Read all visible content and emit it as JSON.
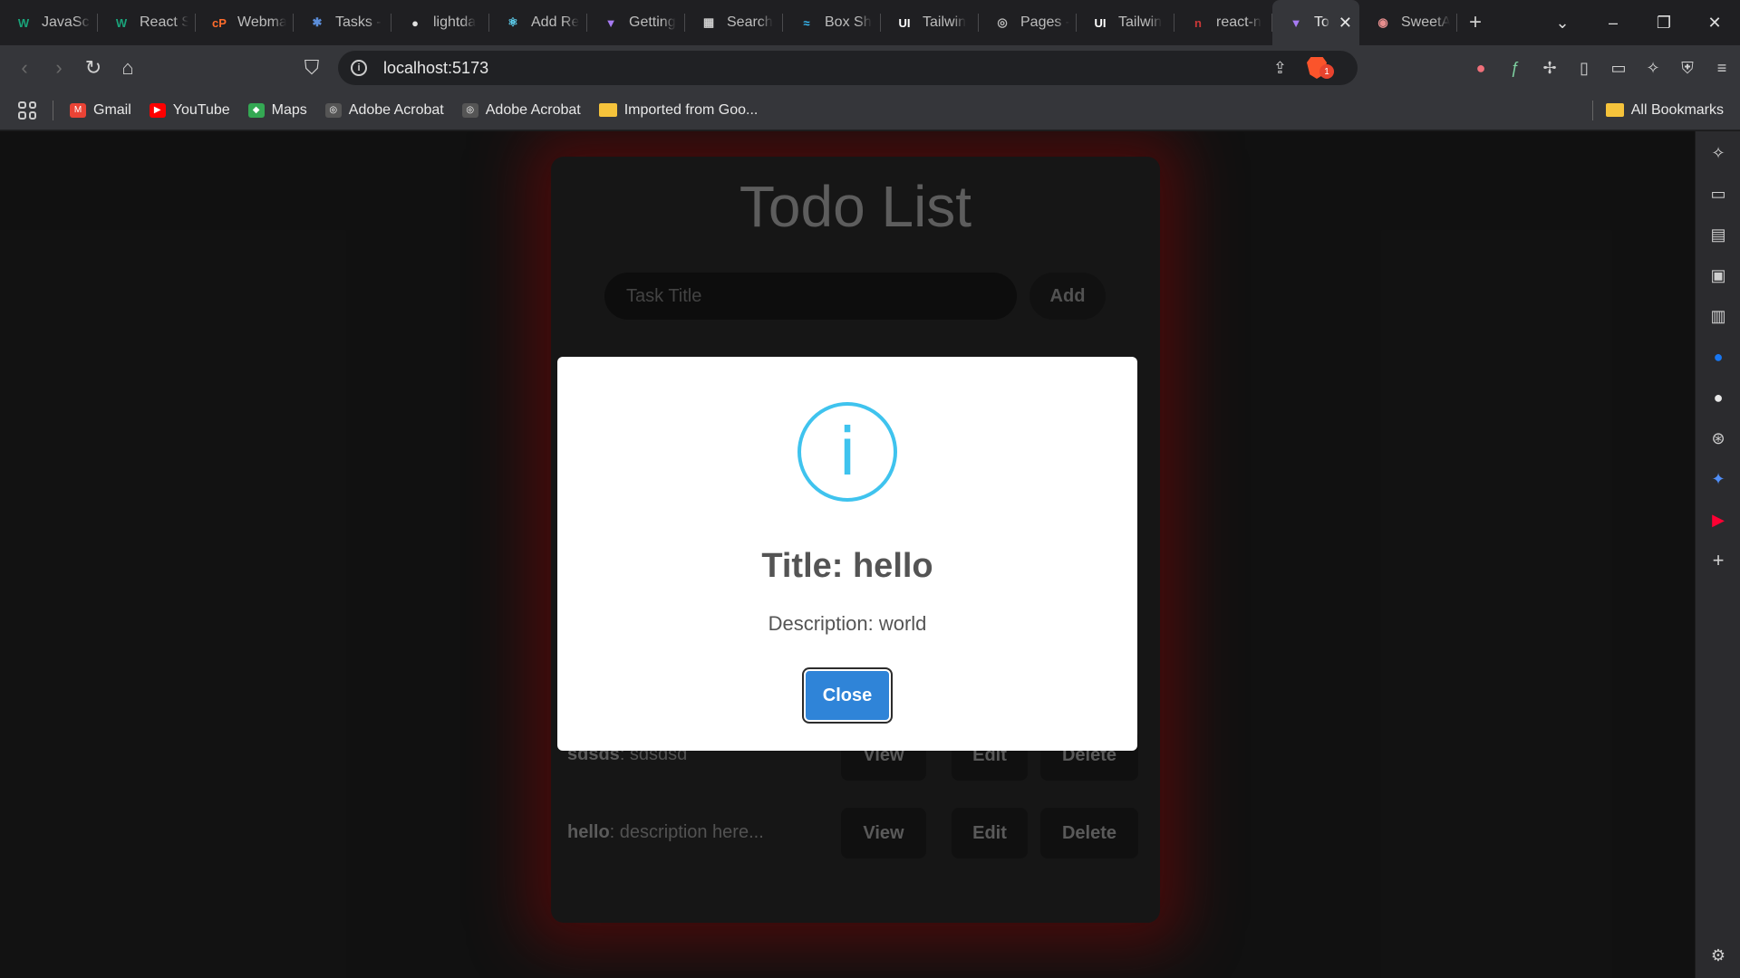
{
  "tabs": [
    {
      "title": "JavaScr",
      "icon": "w-icon",
      "glyph": "W",
      "color": "#1aa37a"
    },
    {
      "title": "React S",
      "icon": "w-icon",
      "glyph": "W",
      "color": "#1aa37a"
    },
    {
      "title": "Webma",
      "icon": "cpanel-icon",
      "glyph": "cP",
      "color": "#ff6c2c"
    },
    {
      "title": "Tasks -",
      "icon": "tasks-icon",
      "glyph": "✱",
      "color": "#5b8dd9"
    },
    {
      "title": "lightda",
      "icon": "github-icon",
      "glyph": "●",
      "color": "#e0e0e0"
    },
    {
      "title": "Add Re",
      "icon": "react-icon",
      "glyph": "⚛",
      "color": "#61dafb"
    },
    {
      "title": "Getting",
      "icon": "vite-icon",
      "glyph": "▼",
      "color": "#a77bf3"
    },
    {
      "title": "Search",
      "icon": "search-page-icon",
      "glyph": "▦",
      "color": "#d0d0d0"
    },
    {
      "title": "Box Sh",
      "icon": "tailwind-icon",
      "glyph": "≈",
      "color": "#38bdf8"
    },
    {
      "title": "Tailwin",
      "icon": "ui-icon",
      "glyph": "UI",
      "color": "#ffffff"
    },
    {
      "title": "Pages -",
      "icon": "globe-icon",
      "glyph": "◎",
      "color": "#bbbbbb"
    },
    {
      "title": "Tailwin",
      "icon": "ui-icon",
      "glyph": "UI",
      "color": "#ffffff"
    },
    {
      "title": "react-n",
      "icon": "npm-icon",
      "glyph": "n",
      "color": "#cb3837"
    }
  ],
  "active_tab": {
    "title": "To",
    "icon": "vite-icon",
    "glyph": "▼",
    "color": "#a77bf3"
  },
  "after_tab": {
    "title": "SweetA",
    "icon": "sweetalert-icon",
    "glyph": "◉",
    "color": "#e88f8f"
  },
  "omnibox": {
    "url": "localhost:5173",
    "badge_count": "1"
  },
  "bookmarks": [
    {
      "label": "Gmail",
      "icon": "gmail-icon",
      "glyph": "M",
      "color": "#ea4335"
    },
    {
      "label": "YouTube",
      "icon": "youtube-icon",
      "glyph": "▶",
      "color": "#ff0000"
    },
    {
      "label": "Maps",
      "icon": "maps-icon",
      "glyph": "◆",
      "color": "#34a853"
    },
    {
      "label": "Adobe Acrobat",
      "icon": "globe-icon",
      "glyph": "◎",
      "color": "#555555"
    },
    {
      "label": "Adobe Acrobat",
      "icon": "globe-icon",
      "glyph": "◎",
      "color": "#555555"
    },
    {
      "label": "Imported from Goo...",
      "icon": "folder-icon",
      "glyph": "",
      "color": "#f5c33b"
    }
  ],
  "all_bookmarks_label": "All Bookmarks",
  "app": {
    "title": "Todo List",
    "input_placeholder": "Task Title",
    "add_label": "Add",
    "todos": [
      {
        "title": "sdsds",
        "description": ": sdsdsd"
      },
      {
        "title": "hello",
        "description": ": description here..."
      }
    ],
    "view_label": "View",
    "edit_label": "Edit",
    "delete_label": "Delete"
  },
  "modal": {
    "icon": "info-icon",
    "glyph": "i",
    "title": "Title: hello",
    "description": "Description: world",
    "close_label": "Close"
  },
  "colors": {
    "modal_accent": "#3fc3ee",
    "close_button": "#2f84d8",
    "card_glow": "#aa0a0a"
  }
}
